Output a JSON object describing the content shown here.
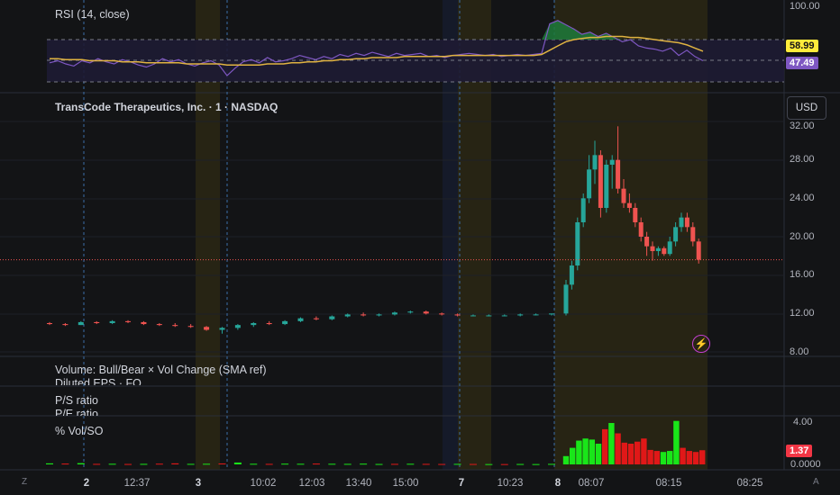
{
  "title_legend": "TransCode Therapeutics, Inc. · 1 · NASDAQ",
  "currency_button": "USD",
  "indicators": {
    "rsi_label": "RSI (14, close)",
    "rsi_value_1": "58.99",
    "rsi_value_2": "47.49",
    "rsi_axis": [
      "100.00"
    ],
    "volume_label": "Volume: Bull/Bear × Vol Change (SMA ref)",
    "eps_label": "Diluted EPS · FQ",
    "ps_label": "P/S ratio",
    "pe_label": "P/E ratio",
    "volso_label": "% Vol/SO",
    "volso_value": "1.37",
    "volso_axis": [
      "4.00",
      "0.0000"
    ]
  },
  "price_axis": [
    "32.00",
    "28.00",
    "24.00",
    "20.00",
    "16.00",
    "12.00",
    "8.00"
  ],
  "time_axis": [
    {
      "label": "2",
      "bold": true
    },
    {
      "label": "12:37",
      "bold": false
    },
    {
      "label": "3",
      "bold": true
    },
    {
      "label": "10:02",
      "bold": false
    },
    {
      "label": "12:03",
      "bold": false
    },
    {
      "label": "13:40",
      "bold": false
    },
    {
      "label": "15:00",
      "bold": false
    },
    {
      "label": "7",
      "bold": true
    },
    {
      "label": "10:23",
      "bold": false
    },
    {
      "label": "8",
      "bold": true
    },
    {
      "label": "08:07",
      "bold": false
    },
    {
      "label": "08:15",
      "bold": false
    },
    {
      "label": "08:25",
      "bold": false
    }
  ],
  "corner_left": "Z",
  "corner_right": "A",
  "colors": {
    "bull": "#26a69a",
    "bear": "#ef5350",
    "rsi_line": "#7e57c2",
    "rsi_ma": "#e0b341",
    "vol_bull": "#19e619",
    "vol_bear": "#e01818",
    "price_line": "#ef5350"
  },
  "chart_data": {
    "type": "candlestick",
    "ylim": [
      8,
      32
    ],
    "candles": [
      {
        "o": 11.0,
        "h": 11.1,
        "l": 10.8,
        "c": 10.9
      },
      {
        "o": 10.9,
        "h": 11.0,
        "l": 10.7,
        "c": 10.8
      },
      {
        "o": 10.8,
        "h": 11.2,
        "l": 10.8,
        "c": 11.1
      },
      {
        "o": 11.1,
        "h": 11.2,
        "l": 10.9,
        "c": 11.0
      },
      {
        "o": 11.0,
        "h": 11.3,
        "l": 10.9,
        "c": 11.2
      },
      {
        "o": 11.2,
        "h": 11.3,
        "l": 11.0,
        "c": 11.1
      },
      {
        "o": 11.1,
        "h": 11.2,
        "l": 10.8,
        "c": 10.9
      },
      {
        "o": 10.9,
        "h": 11.0,
        "l": 10.7,
        "c": 10.8
      },
      {
        "o": 10.8,
        "h": 11.0,
        "l": 10.6,
        "c": 10.7
      },
      {
        "o": 10.7,
        "h": 10.9,
        "l": 10.5,
        "c": 10.6
      },
      {
        "o": 10.6,
        "h": 10.7,
        "l": 10.2,
        "c": 10.3
      },
      {
        "o": 10.3,
        "h": 10.6,
        "l": 9.9,
        "c": 10.5
      },
      {
        "o": 10.5,
        "h": 10.9,
        "l": 10.3,
        "c": 10.8
      },
      {
        "o": 10.8,
        "h": 11.1,
        "l": 10.6,
        "c": 11.0
      },
      {
        "o": 11.0,
        "h": 11.2,
        "l": 10.8,
        "c": 10.9
      },
      {
        "o": 10.9,
        "h": 11.3,
        "l": 10.8,
        "c": 11.2
      },
      {
        "o": 11.2,
        "h": 11.6,
        "l": 11.1,
        "c": 11.5
      },
      {
        "o": 11.5,
        "h": 11.7,
        "l": 11.3,
        "c": 11.4
      },
      {
        "o": 11.4,
        "h": 11.8,
        "l": 11.3,
        "c": 11.7
      },
      {
        "o": 11.7,
        "h": 12.0,
        "l": 11.6,
        "c": 11.9
      },
      {
        "o": 11.9,
        "h": 12.1,
        "l": 11.7,
        "c": 11.8
      },
      {
        "o": 11.8,
        "h": 12.0,
        "l": 11.7,
        "c": 11.9
      },
      {
        "o": 11.9,
        "h": 12.2,
        "l": 11.8,
        "c": 12.1
      },
      {
        "o": 12.1,
        "h": 12.3,
        "l": 12.0,
        "c": 12.2
      },
      {
        "o": 12.2,
        "h": 12.3,
        "l": 11.9,
        "c": 12.0
      },
      {
        "o": 12.0,
        "h": 12.1,
        "l": 11.8,
        "c": 11.9
      },
      {
        "o": 11.9,
        "h": 12.0,
        "l": 11.7,
        "c": 11.8
      },
      {
        "o": 11.8,
        "h": 11.9,
        "l": 11.7,
        "c": 11.8
      },
      {
        "o": 11.8,
        "h": 11.9,
        "l": 11.7,
        "c": 11.8
      },
      {
        "o": 11.8,
        "h": 11.9,
        "l": 11.7,
        "c": 11.8
      },
      {
        "o": 11.8,
        "h": 12.0,
        "l": 11.7,
        "c": 11.9
      },
      {
        "o": 11.9,
        "h": 12.0,
        "l": 11.8,
        "c": 11.9
      },
      {
        "o": 11.9,
        "h": 12.0,
        "l": 11.8,
        "c": 12.0
      },
      {
        "o": 12.0,
        "h": 15.5,
        "l": 11.8,
        "c": 15.0
      },
      {
        "o": 15.0,
        "h": 17.5,
        "l": 14.5,
        "c": 17.0
      },
      {
        "o": 17.0,
        "h": 22.0,
        "l": 16.5,
        "c": 21.5
      },
      {
        "o": 21.5,
        "h": 24.5,
        "l": 21.0,
        "c": 24.0
      },
      {
        "o": 24.0,
        "h": 28.5,
        "l": 23.5,
        "c": 27.0
      },
      {
        "o": 27.0,
        "h": 30.0,
        "l": 25.5,
        "c": 28.5
      },
      {
        "o": 28.5,
        "h": 29.0,
        "l": 22.0,
        "c": 23.0
      },
      {
        "o": 23.0,
        "h": 28.0,
        "l": 22.5,
        "c": 27.5
      },
      {
        "o": 27.5,
        "h": 28.5,
        "l": 25.0,
        "c": 28.0
      },
      {
        "o": 28.0,
        "h": 31.5,
        "l": 24.5,
        "c": 25.0
      },
      {
        "o": 25.0,
        "h": 26.0,
        "l": 23.0,
        "c": 23.5
      },
      {
        "o": 23.5,
        "h": 24.5,
        "l": 22.5,
        "c": 23.0
      },
      {
        "o": 23.0,
        "h": 23.5,
        "l": 21.0,
        "c": 21.5
      },
      {
        "o": 21.5,
        "h": 22.0,
        "l": 19.5,
        "c": 20.0
      },
      {
        "o": 20.0,
        "h": 20.5,
        "l": 18.0,
        "c": 19.0
      },
      {
        "o": 19.0,
        "h": 19.5,
        "l": 17.5,
        "c": 18.5
      },
      {
        "o": 18.5,
        "h": 19.0,
        "l": 18.0,
        "c": 18.8
      },
      {
        "o": 18.8,
        "h": 19.0,
        "l": 18.0,
        "c": 18.2
      },
      {
        "o": 18.2,
        "h": 20.0,
        "l": 18.0,
        "c": 19.5
      },
      {
        "o": 19.5,
        "h": 21.5,
        "l": 19.0,
        "c": 21.0
      },
      {
        "o": 21.0,
        "h": 22.5,
        "l": 20.5,
        "c": 22.0
      },
      {
        "o": 22.0,
        "h": 22.5,
        "l": 20.5,
        "c": 21.0
      },
      {
        "o": 21.0,
        "h": 21.5,
        "l": 19.0,
        "c": 19.5
      },
      {
        "o": 19.5,
        "h": 19.8,
        "l": 17.2,
        "c": 17.6
      }
    ],
    "last_price": 17.6,
    "rsi": {
      "ylim": [
        0,
        100
      ],
      "values": [
        48,
        50,
        47,
        45,
        50,
        48,
        52,
        49,
        47,
        51,
        49,
        46,
        44,
        47,
        52,
        49,
        51,
        47,
        45,
        48,
        50,
        46,
        36,
        43,
        49,
        51,
        48,
        53,
        49,
        50,
        52,
        55,
        53,
        51,
        54,
        52,
        56,
        54,
        57,
        55,
        58,
        56,
        54,
        57,
        55,
        56,
        57,
        54,
        55,
        53,
        55,
        56,
        57,
        56,
        55,
        56,
        54,
        55,
        56,
        55,
        56,
        57,
        85,
        88,
        84,
        80,
        75,
        77,
        73,
        76,
        72,
        68,
        70,
        64,
        62,
        61,
        59,
        62,
        55,
        60,
        54,
        50
      ],
      "ma": [
        52,
        52,
        51,
        51,
        51,
        50,
        50,
        50,
        50,
        49,
        49,
        49,
        48,
        48,
        48,
        48,
        48,
        47,
        47,
        47,
        47,
        47,
        46,
        46,
        46,
        46,
        46,
        47,
        47,
        47,
        48,
        48,
        49,
        49,
        50,
        50,
        51,
        51,
        52,
        52,
        53,
        53,
        53,
        53,
        54,
        54,
        54,
        54,
        54,
        54,
        55,
        55,
        55,
        55,
        55,
        55,
        55,
        55,
        55,
        55,
        55,
        56,
        60,
        64,
        68,
        70,
        71,
        72,
        72,
        73,
        73,
        73,
        72,
        72,
        71,
        70,
        69,
        68,
        67,
        65,
        62,
        59
      ]
    },
    "volso": {
      "ylim": [
        0,
        4
      ],
      "bars": [
        {
          "v": 0.1,
          "up": true
        },
        {
          "v": 0.08,
          "up": false
        },
        {
          "v": 0.12,
          "up": true
        },
        {
          "v": 0.05,
          "up": false
        },
        {
          "v": 0.06,
          "up": true
        },
        {
          "v": 0.04,
          "up": false
        },
        {
          "v": 0.05,
          "up": true
        },
        {
          "v": 0.07,
          "up": false
        },
        {
          "v": 0.1,
          "up": false
        },
        {
          "v": 0.05,
          "up": true
        },
        {
          "v": 0.06,
          "up": true
        },
        {
          "v": 0.09,
          "up": false
        },
        {
          "v": 0.18,
          "up": true
        },
        {
          "v": 0.06,
          "up": true
        },
        {
          "v": 0.05,
          "up": false
        },
        {
          "v": 0.07,
          "up": true
        },
        {
          "v": 0.06,
          "up": true
        },
        {
          "v": 0.08,
          "up": false
        },
        {
          "v": 0.06,
          "up": true
        },
        {
          "v": 0.05,
          "up": true
        },
        {
          "v": 0.07,
          "up": true
        },
        {
          "v": 0.04,
          "up": true
        },
        {
          "v": 0.05,
          "up": false
        },
        {
          "v": 0.06,
          "up": true
        },
        {
          "v": 0.05,
          "up": false
        },
        {
          "v": 0.04,
          "up": false
        },
        {
          "v": 0.05,
          "up": true
        },
        {
          "v": 0.04,
          "up": false
        },
        {
          "v": 0.03,
          "up": true
        },
        {
          "v": 0.03,
          "up": false
        },
        {
          "v": 0.04,
          "up": true
        },
        {
          "v": 0.03,
          "up": true
        },
        {
          "v": 0.05,
          "up": true
        },
        {
          "v": 0.8,
          "up": true
        },
        {
          "v": 1.6,
          "up": true
        },
        {
          "v": 2.3,
          "up": true
        },
        {
          "v": 2.5,
          "up": true
        },
        {
          "v": 2.4,
          "up": true
        },
        {
          "v": 2.0,
          "up": true
        },
        {
          "v": 3.4,
          "up": false
        },
        {
          "v": 4.0,
          "up": true
        },
        {
          "v": 3.0,
          "up": false
        },
        {
          "v": 2.1,
          "up": false
        },
        {
          "v": 2.0,
          "up": false
        },
        {
          "v": 2.2,
          "up": false
        },
        {
          "v": 2.5,
          "up": false
        },
        {
          "v": 1.4,
          "up": false
        },
        {
          "v": 1.3,
          "up": false
        },
        {
          "v": 1.2,
          "up": true
        },
        {
          "v": 1.3,
          "up": true
        },
        {
          "v": 4.2,
          "up": true
        },
        {
          "v": 1.6,
          "up": false
        },
        {
          "v": 1.3,
          "up": false
        },
        {
          "v": 1.2,
          "up": false
        },
        {
          "v": 1.37,
          "up": false
        }
      ]
    }
  }
}
